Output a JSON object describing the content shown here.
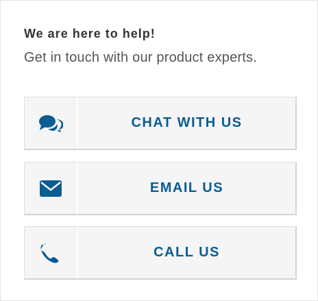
{
  "header": {
    "title": "We are here to help!",
    "subtitle": "Get in touch with our product experts."
  },
  "actions": [
    {
      "label": "CHAT WITH US",
      "icon": "chat-bubbles-icon"
    },
    {
      "label": "EMAIL US",
      "icon": "envelope-icon"
    },
    {
      "label": "CALL US",
      "icon": "phone-icon"
    }
  ],
  "colors": {
    "accent": "#0a5c93",
    "heading": "#333333",
    "subtext": "#555555",
    "button_bg": "#f5f5f5"
  }
}
